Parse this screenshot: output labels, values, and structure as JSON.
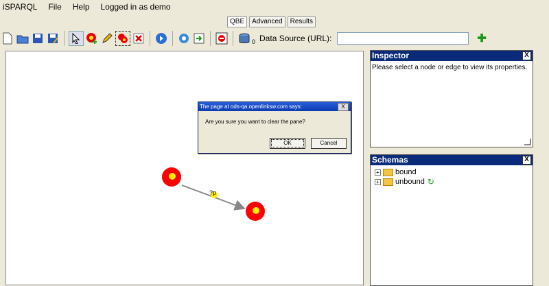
{
  "menu": {
    "app": "iSPARQL",
    "file": "File",
    "help": "Help",
    "login": "Logged in as demo"
  },
  "tabs": [
    "QBE",
    "Advanced",
    "Results"
  ],
  "toolbar": {
    "count": "0",
    "datasource_label": "Data Source (URL):",
    "datasource_value": ""
  },
  "inspector": {
    "title": "Inspector",
    "message": "Please select a node or edge to view its properties.",
    "close": "X"
  },
  "schemas": {
    "title": "Schemas",
    "close": "X",
    "items": [
      "bound",
      "unbound"
    ]
  },
  "graph": {
    "edge_label": "?p"
  },
  "dialog": {
    "title": "The page at ods-qa.openlinksw.com says:",
    "message": "Are you sure you want to clear the pane?",
    "ok": "OK",
    "cancel": "Cancel",
    "close": "X"
  },
  "colors": {
    "node": "#ff0000",
    "node_center": "#ffee00",
    "panel_header": "#0a2a7a"
  }
}
